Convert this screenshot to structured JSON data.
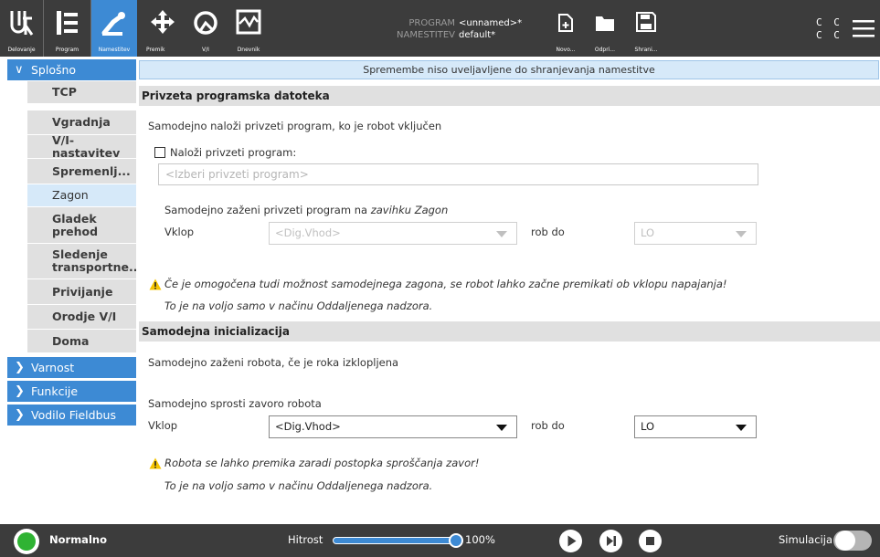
{
  "header": {
    "nav": [
      {
        "id": "operate",
        "label": "Delovanje",
        "icon": "ur-logo-icon"
      },
      {
        "id": "program",
        "label": "Program",
        "icon": "program-tree-icon"
      },
      {
        "id": "installation",
        "label": "Namestitev",
        "icon": "robot-arm-icon"
      },
      {
        "id": "move",
        "label": "Premik",
        "icon": "move-arrows-icon"
      },
      {
        "id": "io",
        "label": "V/I",
        "icon": "io-gauge-icon"
      },
      {
        "id": "log",
        "label": "Dnevnik",
        "icon": "log-chart-icon"
      }
    ],
    "program_label": "PROGRAM",
    "program_value": "<unnamed>*",
    "installation_label": "NAMESTITEV",
    "installation_value": "default*",
    "file_buttons": [
      {
        "label": "Novo...",
        "icon": "new-file-icon"
      },
      {
        "label": "Odpri...",
        "icon": "open-folder-icon"
      },
      {
        "label": "Shrani...",
        "icon": "save-icon"
      }
    ],
    "cc_top": "C C",
    "cc_bottom": "C C",
    "menu_icon": "hamburger-menu-icon"
  },
  "sidebar": {
    "sections": [
      {
        "label": "Splošno",
        "expanded": true
      },
      {
        "label": "Varnost",
        "expanded": false
      },
      {
        "label": "Funkcije",
        "expanded": false
      },
      {
        "label": "Vodilo Fieldbus",
        "expanded": false
      }
    ],
    "items": [
      {
        "label": "TCP",
        "selected": false
      },
      {
        "label": "Vgradnja",
        "selected": false
      },
      {
        "label": "V/I-nastavitev",
        "selected": false
      },
      {
        "label": "Spremenlj...",
        "selected": false
      },
      {
        "label": "Zagon",
        "selected": true
      },
      {
        "label": "Gladek prehod",
        "selected": false
      },
      {
        "label": "Sledenje transportne...",
        "selected": false
      },
      {
        "label": "Privijanje",
        "selected": false
      },
      {
        "label": "Orodje V/I",
        "selected": false
      },
      {
        "label": "Doma",
        "selected": false
      }
    ]
  },
  "content": {
    "notice": "Spremembe niso uveljavljene do shranjevanja namestitve",
    "default_program": {
      "title": "Privzeta programska datoteka",
      "description": "Samodejno naloži privzeti program, ko je robot vključen",
      "checkbox_label": "Naloži privzeti program:",
      "checkbox_checked": false,
      "program_placeholder": "<Izberi privzeti program>",
      "autostart_text_plain": "Samodejno zaženi privzeti program na ",
      "autostart_text_italic": "zavihku Zagon",
      "power_label": "Vklop",
      "power_select": "<Dig.Vhod>",
      "edge_label": "rob do",
      "edge_select": "LO",
      "warning_1": "Če je omogočena tudi možnost samodejnega zagona, se robot lahko začne premikati ob vklopu napajanja!",
      "warning_2": "To je na voljo samo v načinu Oddaljenega nadzora."
    },
    "auto_init": {
      "title": "Samodejna inicializacija",
      "start_text": "Samodejno zaženi robota, če je roka izklopljena",
      "brake_text": "Samodejno sprosti zavoro robota",
      "power_label": "Vklop",
      "power_select": "<Dig.Vhod>",
      "edge_label": "rob do",
      "edge_select": "LO",
      "warning_1": "Robota se lahko premika zaradi postopka sproščanja zavor!",
      "warning_2": "To je na voljo samo v načinu Oddaljenega nadzora."
    }
  },
  "footer": {
    "status_label": "Normalno",
    "status_color": "#2fb333",
    "speed_label": "Hitrost",
    "speed_value": "100%",
    "speed_fraction": 1.0,
    "controls": [
      "play-icon",
      "step-icon",
      "stop-icon"
    ],
    "sim_label": "Simulacija",
    "sim_on": false
  },
  "colors": {
    "accent": "#3d8ad4",
    "header_bg": "#3c3c3c",
    "selected_bg": "#d6e9f9",
    "section_bg": "#e0e0e0",
    "warning": "#f5c400"
  }
}
